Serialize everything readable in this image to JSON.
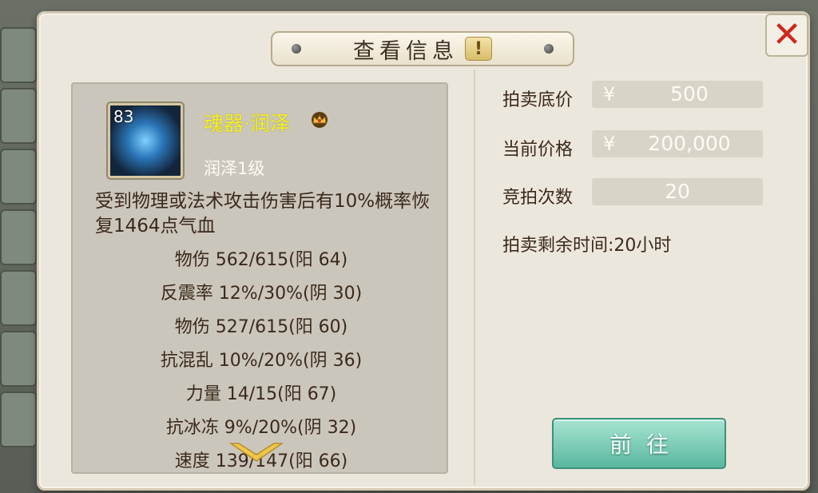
{
  "modal": {
    "title": "查看信息",
    "info_badge": "!"
  },
  "item": {
    "level": "83",
    "name": "魂器·润泽",
    "subtitle": "润泽1级",
    "description": "受到物理或法术攻击伤害后有10%概率恢复1464点气血",
    "stats": [
      "物伤 562/615(阳 64)",
      "反震率 12%/30%(阴 30)",
      "物伤 527/615(阳 60)",
      "抗混乱 10%/20%(阴 36)",
      "力量 14/15(阳 67)",
      "抗冰冻 9%/20%(阴 32)",
      "速度 139/147(阳 66)"
    ]
  },
  "auction": {
    "base_price_label": "拍卖底价",
    "base_price_currency": "¥",
    "base_price_value": "500",
    "current_price_label": "当前价格",
    "current_price_currency": "¥",
    "current_price_value": "200,000",
    "bid_count_label": "竞拍次数",
    "bid_count_value": "20",
    "remaining_time": "拍卖剩余时间:20小时"
  },
  "actions": {
    "go_label": "前往"
  },
  "colors": {
    "item_name": "#f4f02a",
    "close_x": "#d0241c",
    "go_button": "#59b79f"
  },
  "icons": [
    "close-icon",
    "crown-icon",
    "info-icon",
    "scroll-down-icon",
    "item-icon"
  ]
}
